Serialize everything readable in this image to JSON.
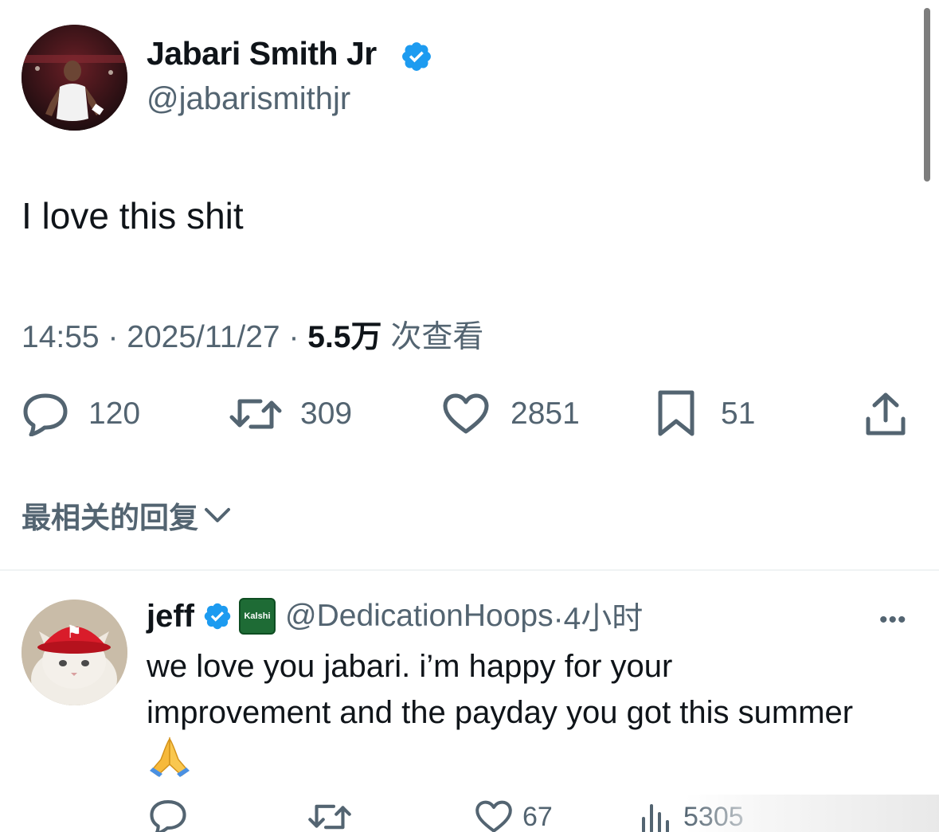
{
  "tweet": {
    "author": {
      "name": "Jabari Smith Jr",
      "handle": "@jabarismithjr",
      "verified": true,
      "avatar_icon": "player-avatar"
    },
    "text": "I love this shit",
    "time": "14:55",
    "date": "2025/11/27",
    "views_count": "5.5万",
    "views_label": "次查看",
    "separator": "·",
    "actions": {
      "replies": "120",
      "retweets": "309",
      "likes": "2851",
      "bookmarks": "51"
    }
  },
  "replies_sort_label": "最相关的回复",
  "reply": {
    "author": {
      "name": "jeff",
      "handle": "@DedicationHoops",
      "verified": true,
      "affiliate_badge": "Kalshi",
      "avatar_icon": "cat-with-rockets-cap-avatar"
    },
    "time": "·4小时",
    "text": "we love you jabari. i’m happy for your improvement and the payday you got this summer",
    "emoji": "🙏",
    "actions": {
      "likes": "67",
      "views": "5305"
    }
  },
  "colors": {
    "text": "#0f1419",
    "secondary": "#536471",
    "verified": "#1d9bf0",
    "divider": "#eff3f4",
    "kalshi": "#1e6b35"
  }
}
